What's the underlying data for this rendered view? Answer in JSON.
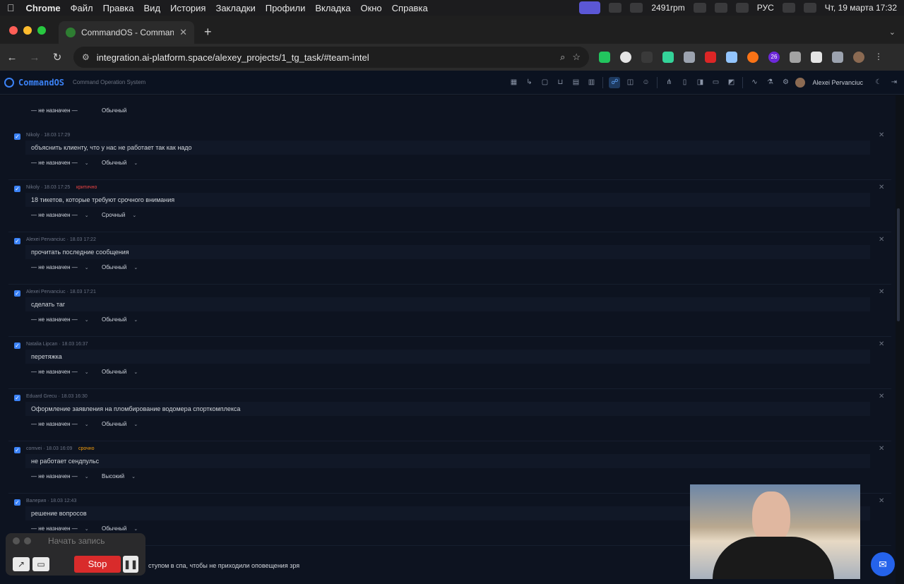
{
  "menubar": {
    "app": "Chrome",
    "items": [
      "Файл",
      "Правка",
      "Вид",
      "История",
      "Закладки",
      "Профили",
      "Вкладка",
      "Окно",
      "Справка"
    ],
    "rpm": "2491rpm",
    "lang": "РУС",
    "datetime": "Чт, 19 марта  17:32"
  },
  "browser": {
    "tab_title": "CommandOS - Command Op",
    "url": "integration.ai-platform.space/alexey_projects/1_tg_task/#team-intel",
    "ext_badge": "26"
  },
  "app": {
    "brand": "CommandOS",
    "subtitle": "Command Operation System",
    "user": "Alexei Pervanciuc"
  },
  "partial_top": {
    "assignee": "— не назначен —",
    "priority": "Обычный"
  },
  "tasks": [
    {
      "meta": "Nikoly · 18.03 17:29",
      "tag": "",
      "text": "объяснить клиенту, что у нас не работает так как надо",
      "assignee": "— не назначен —",
      "priority": "Обычный"
    },
    {
      "meta": "Nikoly · 18.03 17:25",
      "tag": "критично",
      "tag_kind": "critical",
      "text": "18 тикетов, которые требуют срочного внимания",
      "assignee": "— не назначен —",
      "priority": "Срочный"
    },
    {
      "meta": "Alexei Pervanciuc · 18.03 17:22",
      "tag": "",
      "text": "прочитать последние сообщения",
      "assignee": "— не назначен —",
      "priority": "Обычный"
    },
    {
      "meta": "Alexei Pervanciuc · 18.03 17:21",
      "tag": "",
      "text": "сделать таг",
      "assignee": "— не назначен —",
      "priority": "Обычный"
    },
    {
      "meta": "Natalia Lipcan · 18.03 16:37",
      "tag": "",
      "text": "перетяжка",
      "assignee": "— не назначен —",
      "priority": "Обычный"
    },
    {
      "meta": "Eduard Grecu · 18.03 16:30",
      "tag": "",
      "text": "Оформление заявления на пломбирование водомера спорткомплекса",
      "assignee": "— не назначен —",
      "priority": "Обычный"
    },
    {
      "meta": "comvei · 18.03 16:09",
      "tag": "срочно",
      "tag_kind": "urgent",
      "text": "не работает сендпульс",
      "assignee": "— не назначен —",
      "priority": "Высокий"
    },
    {
      "meta": "Валерия · 18.03 12:43",
      "tag": "",
      "text": "решение вопросов",
      "assignee": "— не назначен —",
      "priority": "Обычный"
    }
  ],
  "recorder": {
    "title": "Начать запись",
    "stop": "Stop"
  },
  "bottom_text": "ступом в спа, чтобы не приходили оповещения зря"
}
